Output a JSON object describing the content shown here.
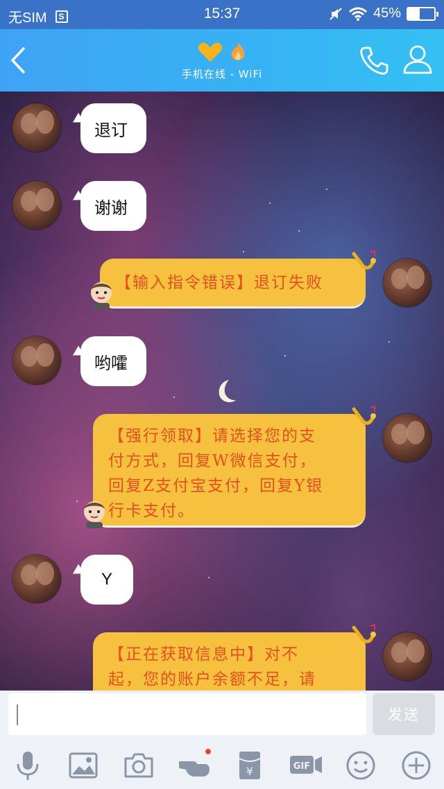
{
  "status_bar": {
    "carrier": "无SIM",
    "sim_badge": "S",
    "time": "15:37",
    "battery": "45%",
    "battery_level": 0.45
  },
  "header": {
    "subtitle": "手机在线 - WiFi",
    "icons": [
      "back-icon",
      "heart-icon",
      "flame-icon",
      "phone-icon",
      "profile-icon"
    ],
    "accent": "#36b3f4"
  },
  "messages": [
    {
      "side": "left",
      "text": "退订"
    },
    {
      "side": "left",
      "text": "谢谢"
    },
    {
      "side": "right",
      "lines": [
        "【输入指令错误】退订失败"
      ]
    },
    {
      "side": "left",
      "text": "哟嚯"
    },
    {
      "side": "right",
      "lines": [
        "【强行领取】请选择您的支",
        "付方式，回复W微信支付，",
        "回复Z支付宝支付，回复Y银",
        "行卡支付。"
      ]
    },
    {
      "side": "left",
      "text": "Y"
    },
    {
      "side": "right",
      "lines": [
        "【正在获取信息中】对不",
        "起，您的账户余额不足，请"
      ]
    }
  ],
  "input": {
    "placeholder": "",
    "send_label": "发送"
  },
  "toolbar": {
    "icons": [
      "microphone-icon",
      "image-icon",
      "camera-icon",
      "poke-icon",
      "red-packet-icon",
      "gif-icon",
      "emoji-icon",
      "plus-icon"
    ],
    "poke_badge_color": "#ff3b30"
  },
  "colors": {
    "bubble_yellow": "#f6c13e",
    "bubble_text": "#e5501f"
  }
}
